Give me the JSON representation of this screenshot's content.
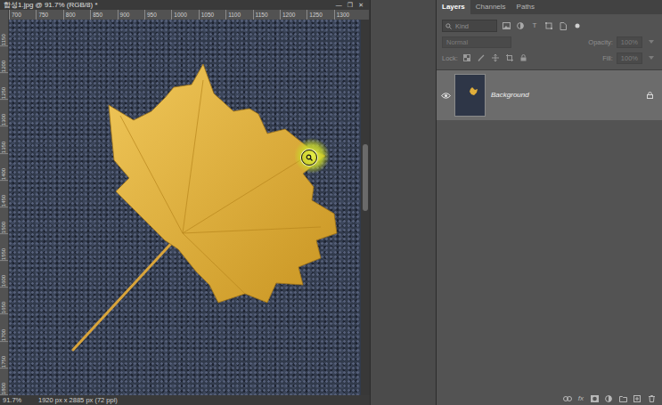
{
  "document": {
    "title": "합성1.jpg @ 91.7% (RGB/8) *",
    "window_controls": [
      "—",
      "❐",
      "✕"
    ],
    "zoom": "91.7%",
    "dimensions": "1920 px x 2885 px (72 ppi)"
  },
  "ruler": {
    "horizontal": [
      "700",
      "750",
      "800",
      "850",
      "900",
      "950",
      "1000",
      "1050",
      "1100",
      "1150",
      "1200",
      "1250",
      "1300"
    ],
    "vertical": [
      "1150",
      "1200",
      "1250",
      "1300",
      "1350",
      "1400",
      "1450",
      "1500",
      "1550",
      "1600",
      "1650",
      "1700",
      "1750",
      "1800"
    ]
  },
  "layers_panel": {
    "tabs": [
      {
        "label": "Layers",
        "selected": true
      },
      {
        "label": "Channels",
        "selected": false
      },
      {
        "label": "Paths",
        "selected": false
      }
    ],
    "filter": {
      "placeholder": "Kind",
      "type_icon": "T"
    },
    "blend_mode": {
      "value": "Normal",
      "disabled": true
    },
    "opacity": {
      "label": "Opacity:",
      "value": "100%",
      "disabled": true
    },
    "lock_label": "Lock:",
    "fill": {
      "label": "Fill:",
      "value": "100%",
      "disabled": true
    },
    "layers": [
      {
        "name": "Background",
        "visible": true,
        "locked": true,
        "selected": true
      }
    ],
    "footer_fx": "fx"
  }
}
